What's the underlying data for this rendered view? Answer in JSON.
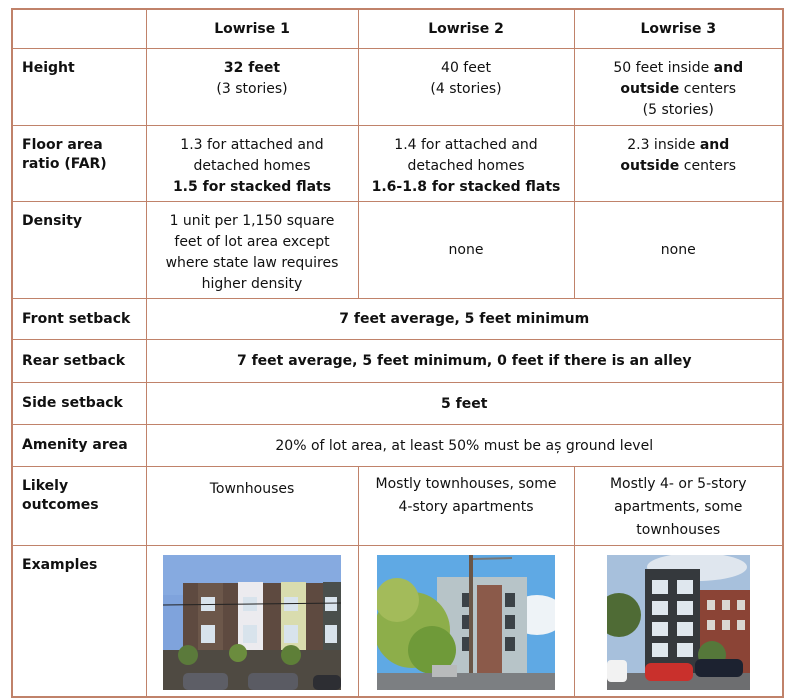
{
  "columns": [
    "",
    "Lowrise 1",
    "Lowrise 2",
    "Lowrise 3"
  ],
  "rows": {
    "height": {
      "label": "Height",
      "lr1": {
        "line1": "32 feet",
        "line2": "(3 stories)"
      },
      "lr2": {
        "line1": "40 feet",
        "line2": "(4 stories)"
      },
      "lr3": {
        "pre": "50 feet inside ",
        "bold1": "and",
        "bold2": "outside",
        "post": " centers",
        "line3": "(5 stories)"
      }
    },
    "far": {
      "label_line1": "Floor area",
      "label_line2": "ratio (FAR)",
      "lr1": {
        "line1": "1.3 for attached and",
        "line2": "detached homes",
        "line3": "1.5 for stacked flats"
      },
      "lr2": {
        "line1": "1.4 for attached and",
        "line2": "detached homes",
        "line3": "1.6-1.8 for stacked flats"
      },
      "lr3": {
        "pre": "2.3 inside ",
        "bold1": "and",
        "bold2": "outside",
        "post": " centers"
      }
    },
    "density": {
      "label": "Density",
      "lr1": {
        "line1": "1 unit per 1,150 square",
        "line2": "feet of lot area except",
        "line3": "where state law requires",
        "line4": "higher density"
      },
      "lr2": "none",
      "lr3": "none"
    },
    "front_setback": {
      "label": "Front setback",
      "value": "7 feet average, 5 feet minimum"
    },
    "rear_setback": {
      "label": "Rear setback",
      "value": "7 feet average, 5 feet minimum, 0 feet if there is an alley"
    },
    "side_setback": {
      "label": "Side setback",
      "value": "5 feet"
    },
    "amenity_area": {
      "label": "Amenity area",
      "value": "20% of lot area, at least 50% must be aș ground level"
    },
    "likely_outcomes": {
      "label_line1": "Likely",
      "label_line2": "outcomes",
      "lr1": {
        "line1": "Townhouses"
      },
      "lr2": {
        "line1": "Mostly townhouses, some",
        "line2": "4-story apartments"
      },
      "lr3": {
        "line1": "Mostly 4- or 5-story",
        "line2": "apartments, some",
        "line3": "townhouses"
      }
    },
    "examples": {
      "label": "Examples",
      "lr1_image": "townhouses-photo",
      "lr2_image": "4-story-apartment-photo",
      "lr3_image": "5-story-apartment-photo"
    }
  },
  "colors": {
    "border": "#c0826a",
    "text": "#111111"
  }
}
